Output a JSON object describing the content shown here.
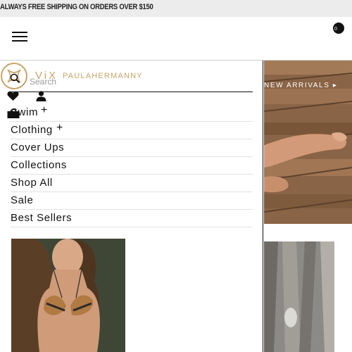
{
  "promo": {
    "text": "ALWAYS FREE SHIPPING ON ORDERS OVER $150"
  },
  "header": {
    "menu_icon": "hamburger-menu-icon",
    "cart_icon": "shopping-bag-icon",
    "cart_count": "0"
  },
  "hero": {
    "label": "NEW ARRIVALS ▸"
  },
  "menu": {
    "logo": {
      "mark": "ViX",
      "brand": "PAULAHERMANNY",
      "color": "#c7a46a"
    },
    "search": {
      "placeholder": "Search"
    },
    "icons": [
      "heart-icon",
      "user-icon",
      "shopping-bag-icon"
    ],
    "items": [
      {
        "label": "Swim",
        "expandable": true
      },
      {
        "label": "Clothing",
        "expandable": true
      },
      {
        "label": "Cover Ups",
        "expandable": false
      },
      {
        "label": "Collections",
        "expandable": false
      },
      {
        "label": "Shop All",
        "expandable": false
      },
      {
        "label": "Sale",
        "expandable": false
      },
      {
        "label": "Best Sellers",
        "expandable": false
      }
    ],
    "plus_symbol": "+"
  },
  "colors": {
    "promo_bg": "#ececec",
    "accent": "#c7a46a",
    "text": "#111111"
  }
}
